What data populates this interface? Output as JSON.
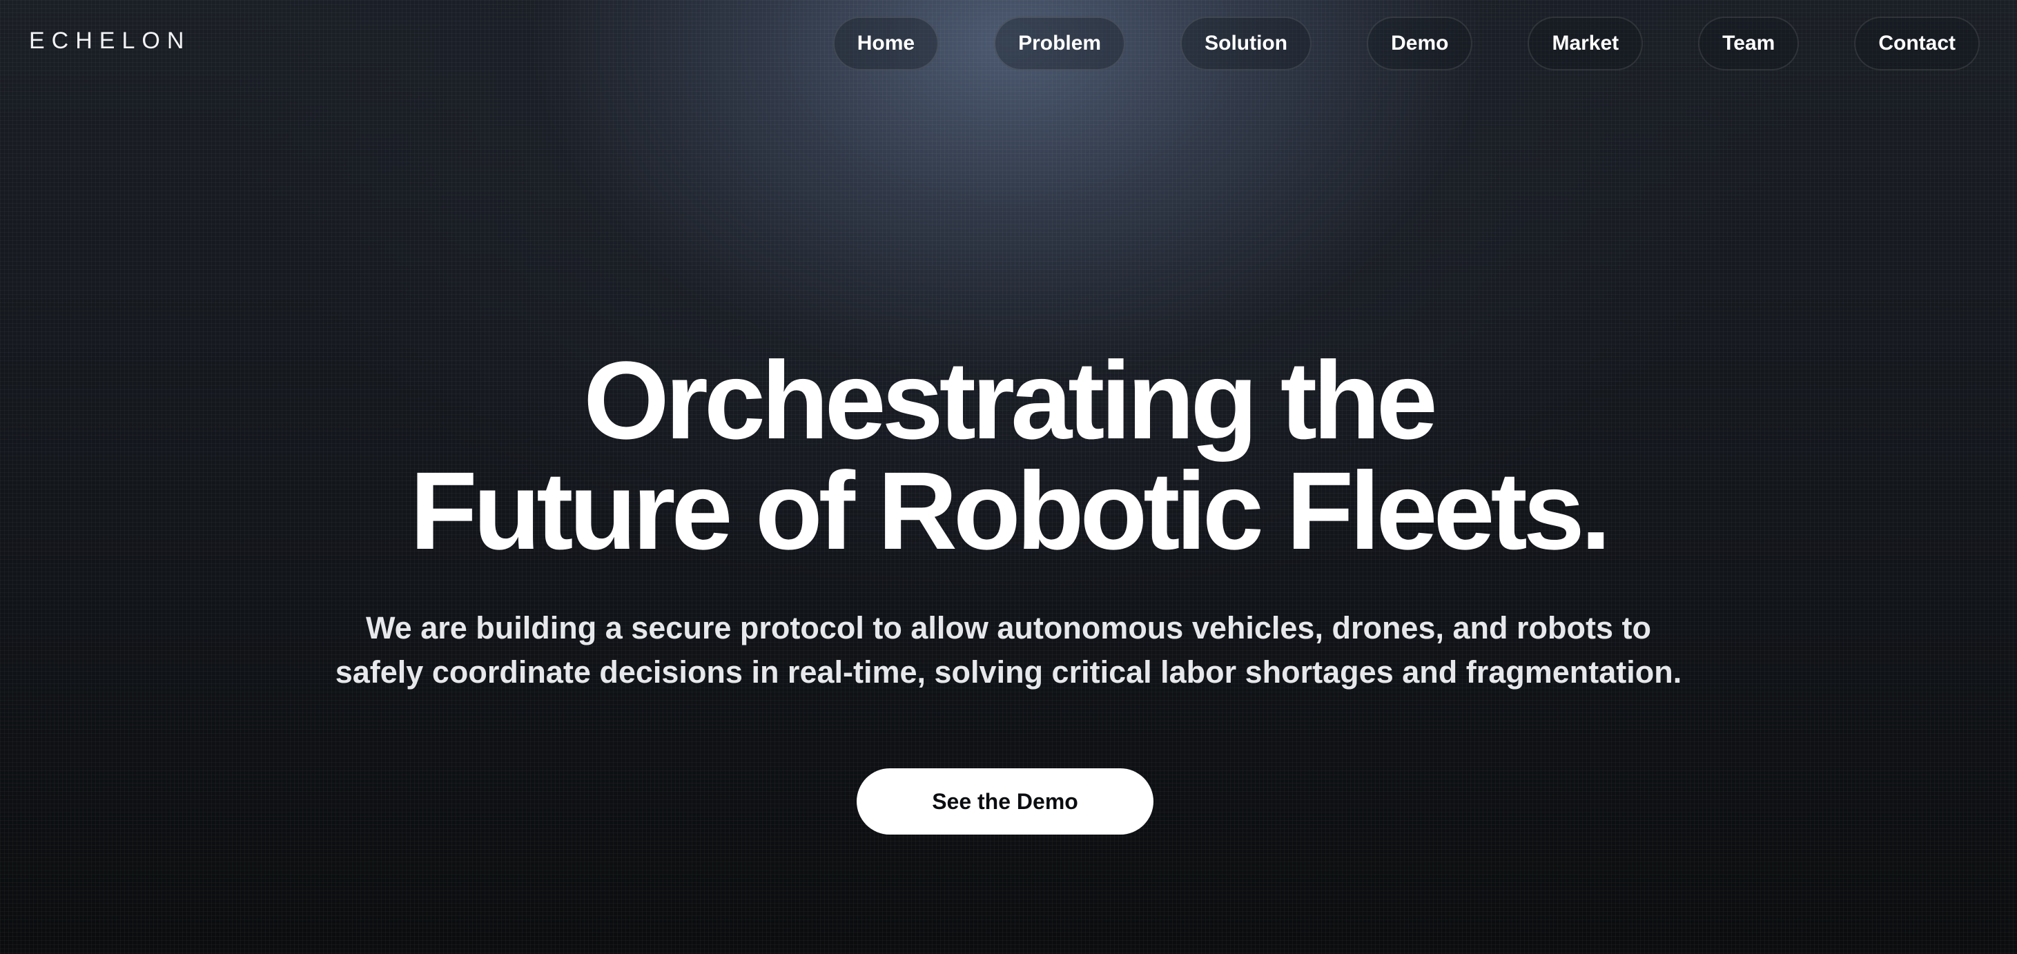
{
  "brand": {
    "logo": "ECHELON"
  },
  "nav": {
    "items": [
      {
        "label": "Home"
      },
      {
        "label": "Problem"
      },
      {
        "label": "Solution"
      },
      {
        "label": "Demo"
      },
      {
        "label": "Market"
      },
      {
        "label": "Team"
      },
      {
        "label": "Contact"
      }
    ]
  },
  "hero": {
    "headline_line1": "Orchestrating the",
    "headline_line2": "Future of Robotic Fleets.",
    "subtext_line1": "We are building a secure protocol to allow autonomous vehicles, drones, and robots to",
    "subtext_line2": "safely coordinate decisions in real-time, solving critical labor shortages and fragmentation.",
    "cta_label": "See the Demo"
  },
  "colors": {
    "background": "#0b0d10",
    "glow": "#4e5c74",
    "text": "#ffffff",
    "cta_background": "#ffffff",
    "cta_text": "#0b0d10"
  }
}
